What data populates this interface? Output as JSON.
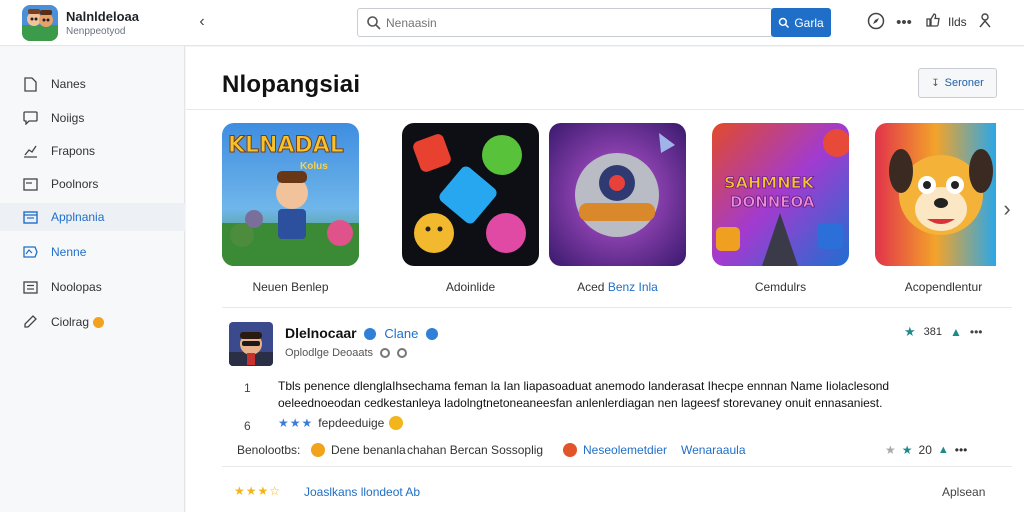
{
  "app": {
    "name": "Nalnldeloaa",
    "subtitle": "Nenppeotyod"
  },
  "search": {
    "placeholder": "Nenaasin",
    "button_label": "Garla"
  },
  "toolbar": {
    "label": "Ilds"
  },
  "sidebar": {
    "items": [
      {
        "label": "Nanes",
        "icon": "file-icon"
      },
      {
        "label": "Noiigs",
        "icon": "chat-icon"
      },
      {
        "label": "Frapons",
        "icon": "chart-icon"
      },
      {
        "label": "Poolnors",
        "icon": "card-icon"
      },
      {
        "label": "Applnania",
        "icon": "window-icon",
        "active": true
      },
      {
        "label": "Nenne",
        "icon": "tag-icon"
      },
      {
        "label": "Noolopas",
        "icon": "list-icon"
      },
      {
        "label": "Ciolrag",
        "icon": "edit-icon"
      }
    ]
  },
  "main": {
    "title": "Nlopangsiai",
    "top_action_label": "Seroner",
    "tiles": [
      {
        "caption": "Neuen Benlep",
        "art_text": "KLNADAL",
        "art_sub": "Kolus"
      },
      {
        "caption": "Adoinlide"
      },
      {
        "caption_plain": "Aced ",
        "caption_hl": "Benz Inla"
      },
      {
        "caption": "Cemdulrs",
        "art_text": "SAHMNEK",
        "art_sub": "DONNEOA"
      },
      {
        "caption": "Acopendlentur"
      }
    ],
    "post": {
      "author": "Dlelnocaar",
      "tag": "Clane",
      "meta": "Oplodlge Deoaats",
      "likes": "381",
      "gutter": [
        "1",
        "6"
      ],
      "body_line_1": "Tbls penence dlenglaIhsechama feman la Ian liapasoaduat anemodo landerasat Ihecpe ennnan Name Iiolaclesond",
      "body_line_2": "oeleednoeodan cedkestanleya ladolngtnetoneaneesfan anlenlerdiagan nen lageesf storevaney onuit ennasaniest.",
      "rating_text": "fepdeeduige",
      "actions": {
        "left": "Benolootbs:",
        "a1": "Dene benanla",
        "a2": "chahan Bercan Sossoplig",
        "a3": "Neseolemetdier",
        "a4": "Wenaraaula",
        "count": "20"
      }
    },
    "footer": {
      "link": "Joaslkans llondeot Ab",
      "right": "Aplsean"
    }
  },
  "colors": {
    "accent": "#1f6fc9",
    "star_gold": "#f2b51c",
    "badge_orange": "#f4a21c"
  }
}
